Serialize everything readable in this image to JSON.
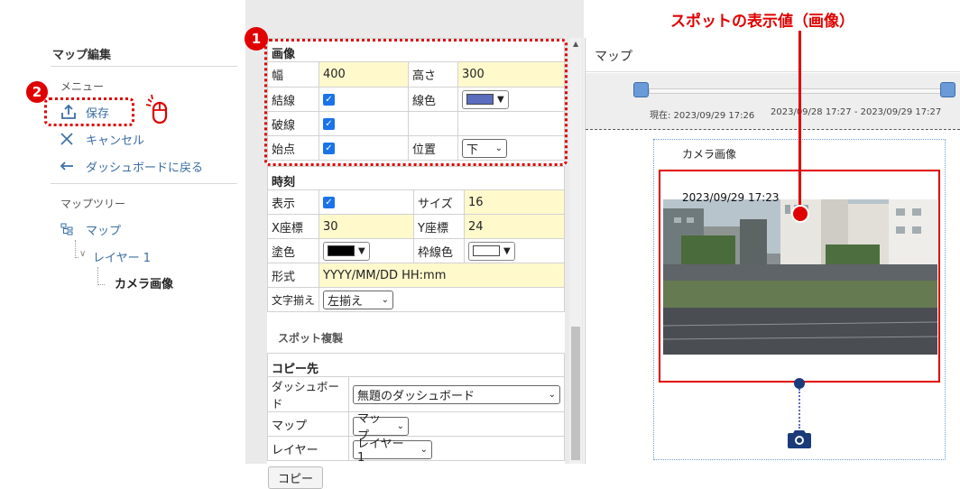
{
  "sidebar": {
    "title": "マップ編集",
    "menu_section": "メニュー",
    "save": "保存",
    "cancel": "キャンセル",
    "back": "ダッシュボードに戻る",
    "tree_section": "マップツリー",
    "tree_map": "マップ",
    "tree_layer": "レイヤー 1",
    "tree_camera": "カメラ画像"
  },
  "image_props": {
    "header": "画像",
    "width_label": "幅",
    "width_value": "400",
    "height_label": "高さ",
    "height_value": "300",
    "line_label": "結線",
    "line_color_label": "線色",
    "dashed_label": "破線",
    "start_label": "始点",
    "position_label": "位置",
    "position_value": "下",
    "line_color": "#5b6dbe"
  },
  "time_props": {
    "header": "時刻",
    "display_label": "表示",
    "size_label": "サイズ",
    "size_value": "16",
    "x_label": "X座標",
    "x_value": "30",
    "y_label": "Y座標",
    "y_value": "24",
    "fill_label": "塗色",
    "stroke_label": "枠線色",
    "format_label": "形式",
    "format_value": "YYYY/MM/DD HH:mm",
    "align_label": "文字揃え",
    "align_value": "左揃え",
    "fill_color": "#000000",
    "stroke_color": "#ffffff"
  },
  "spot_copy": {
    "title": "スポット複製",
    "header": "コピー先",
    "dashboard_label": "ダッシュボード",
    "dashboard_value": "無題のダッシュボード",
    "map_label": "マップ",
    "map_value": "マップ",
    "layer_label": "レイヤー",
    "layer_value": "レイヤー 1",
    "copy_button": "コピー"
  },
  "map_panel": {
    "title": "マップ",
    "current": "現在: 2023/09/29 17:26",
    "range": "2023/09/28 17:27 - 2023/09/29 17:27",
    "spot_title": "カメラ画像",
    "timestamp": "2023/09/29 17:23"
  },
  "annotations": {
    "callout": "スポットの表示値（画像）",
    "badge1": "1",
    "badge2": "2"
  },
  "colors": {
    "accent": "#3a6ea5",
    "annotation": "#e00000",
    "highlight": "#fff9cc",
    "camera_icon": "#1a3a7a"
  }
}
